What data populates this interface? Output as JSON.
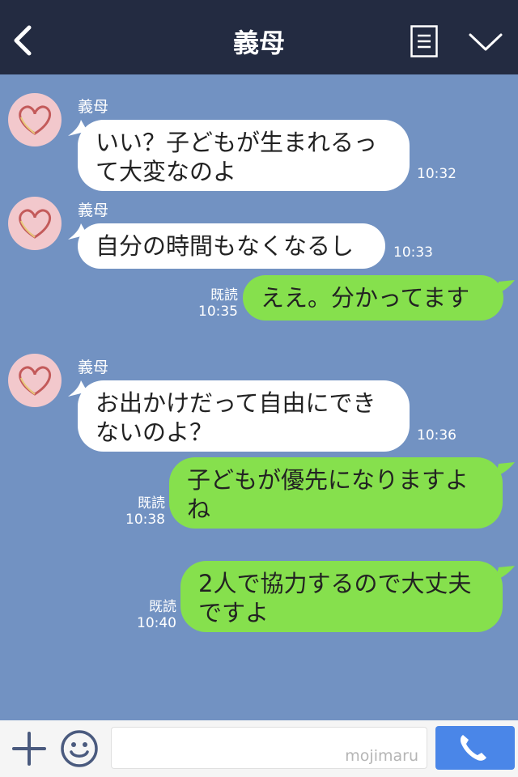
{
  "header": {
    "title": "義母"
  },
  "messages": [
    {
      "type": "in",
      "sender": "義母",
      "lines": [
        "いい？子どもが生まれるっ",
        "て大変なのよ"
      ],
      "time": "10:32"
    },
    {
      "type": "in",
      "sender": "義母",
      "lines": [
        "自分の時間もなくなるし"
      ],
      "time": "10:33"
    },
    {
      "type": "out",
      "lines": [
        "ええ。分かってます"
      ],
      "read": "既読",
      "time": "10:35"
    },
    {
      "type": "in",
      "sender": "義母",
      "lines": [
        "お出かけだって自由にでき",
        "ないのよ？"
      ],
      "time": "10:36"
    },
    {
      "type": "out",
      "lines": [
        "子どもが優先になりますよ",
        "ね"
      ],
      "read": "既読",
      "time": "10:38"
    },
    {
      "type": "out",
      "lines": [
        "2人で協力するので大丈夫",
        "ですよ"
      ],
      "read": "既読",
      "time": "10:40"
    }
  ],
  "input": {
    "placeholder": "",
    "watermark": "mojimaru"
  },
  "icons": {
    "back": "back-icon",
    "menu": "menu-icon",
    "chevron": "chevron-down-icon",
    "plus": "plus-icon",
    "emoji": "emoji-icon",
    "phone": "phone-icon"
  },
  "colors": {
    "header_bg": "#232b41",
    "chat_bg": "#7292c2",
    "incoming_bubble": "#ffffff",
    "outgoing_bubble": "#86e04d",
    "call_button": "#4a86e8"
  }
}
